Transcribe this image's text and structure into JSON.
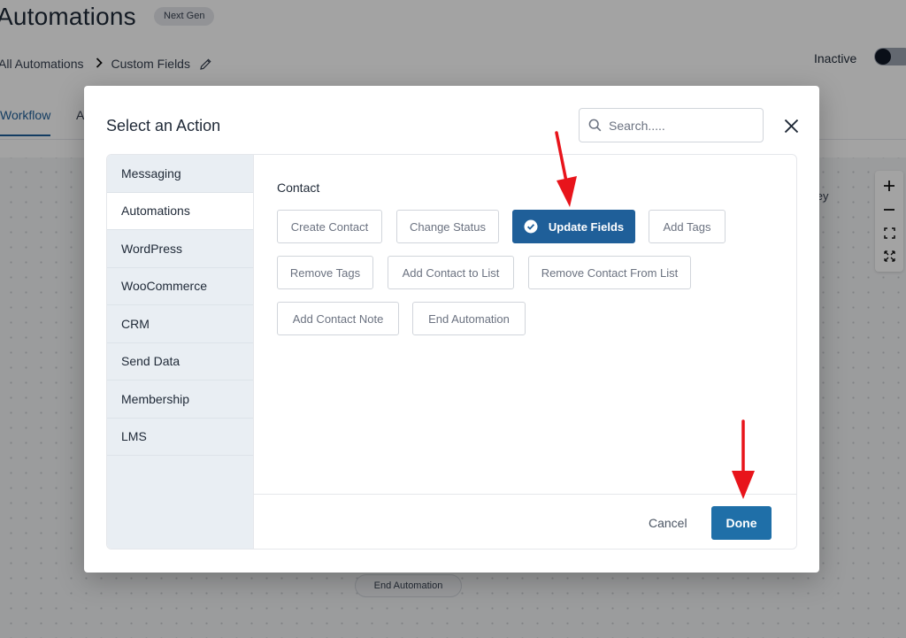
{
  "page": {
    "title": "Automations",
    "badge": "Next Gen",
    "breadcrumb": {
      "root": "All Automations",
      "separator": "›",
      "current": "Custom Fields"
    },
    "status_label": "Inactive",
    "tabs": [
      "Workflow",
      "A"
    ],
    "journey_fragment": "urney",
    "canvas_node": "End Automation",
    "zoom_controls": [
      "zoom-in-icon",
      "zoom-out-icon",
      "fit-screen-icon",
      "fullscreen-icon"
    ]
  },
  "modal": {
    "title": "Select an Action",
    "search_placeholder": "Search.....",
    "sidebar": [
      {
        "label": "Messaging",
        "active": false
      },
      {
        "label": "Automations",
        "active": true
      },
      {
        "label": "WordPress",
        "active": false
      },
      {
        "label": "WooCommerce",
        "active": false
      },
      {
        "label": "CRM",
        "active": false
      },
      {
        "label": "Send Data",
        "active": false
      },
      {
        "label": "Membership",
        "active": false
      },
      {
        "label": "LMS",
        "active": false
      }
    ],
    "section_title": "Contact",
    "actions": [
      {
        "label": "Create Contact",
        "selected": false
      },
      {
        "label": "Change Status",
        "selected": false
      },
      {
        "label": "Update Fields",
        "selected": true
      },
      {
        "label": "Add Tags",
        "selected": false
      },
      {
        "label": "Remove Tags",
        "selected": false
      },
      {
        "label": "Add Contact to List",
        "selected": false
      },
      {
        "label": "Remove Contact From List",
        "selected": false
      },
      {
        "label": "Add Contact Note",
        "selected": false
      },
      {
        "label": "End Automation",
        "selected": false
      }
    ],
    "cancel_label": "Cancel",
    "done_label": "Done"
  },
  "colors": {
    "primary": "#1f5f99",
    "done": "#1f6fa8",
    "annotation_arrow": "#e8141b"
  }
}
